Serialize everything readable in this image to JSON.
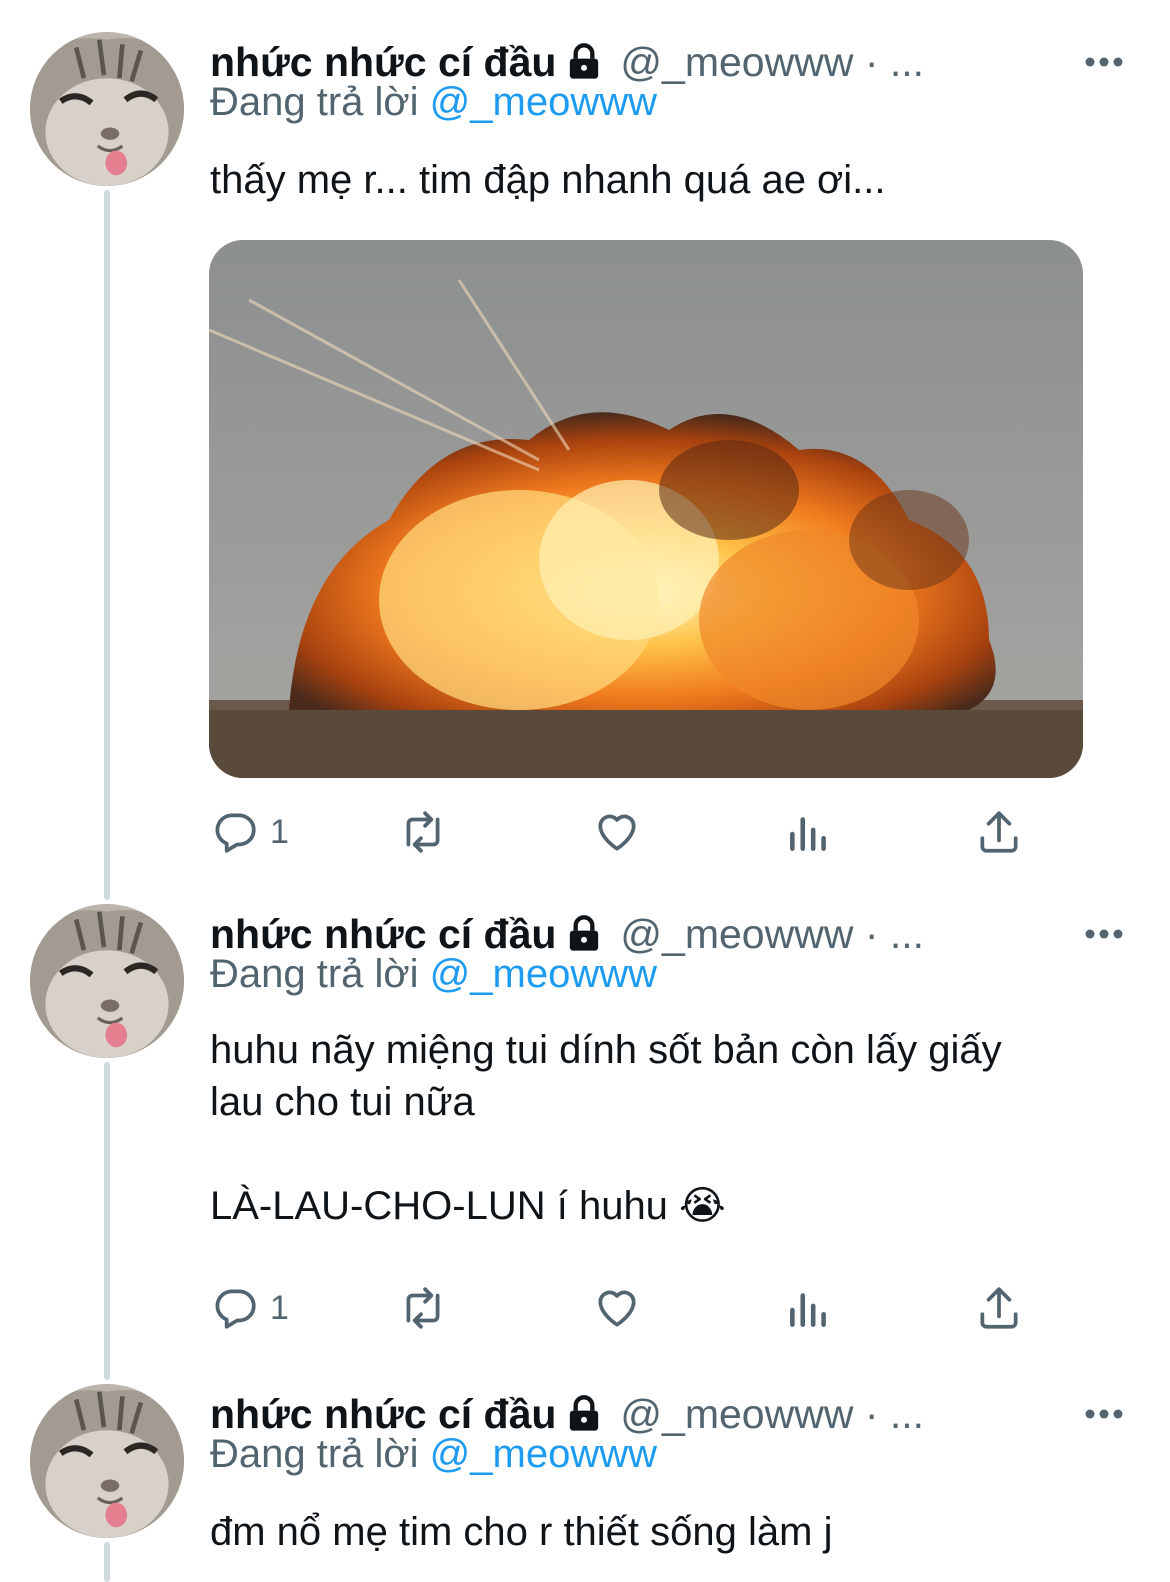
{
  "tweets": [
    {
      "display_name": "nhức nhức cí đầu",
      "handle": "@_meowww · ...",
      "reply_prefix": "Đang trả lời",
      "reply_mention": "@_meowww",
      "text": "thấy mẹ r... tim đập nhanh quá ae ơi...",
      "has_media": true,
      "reply_count": "1"
    },
    {
      "display_name": "nhức nhức cí đầu",
      "handle": "@_meowww · ...",
      "reply_prefix": "Đang trả lời",
      "reply_mention": "@_meowww",
      "text": "huhu nãy miệng tui dính sốt bản còn lấy giấy\nlau cho tui nữa\n\nLÀ-LAU-CHO-LUN í huhu 😭",
      "has_media": false,
      "reply_count": "1"
    },
    {
      "display_name": "nhức nhức cí đầu",
      "handle": "@_meowww · ...",
      "reply_prefix": "Đang trả lời",
      "reply_mention": "@_meowww",
      "text": "đm nổ mẹ tim cho r thiết sống làm j",
      "has_media": false,
      "reply_count": ""
    }
  ],
  "icons": {
    "reply": "reply-icon",
    "retweet": "retweet-icon",
    "like": "heart-icon",
    "views": "views-icon",
    "share": "share-icon",
    "lock": "lock-icon",
    "more": "more-icon"
  },
  "colors": {
    "text": "#0f1419",
    "secondary": "#536471",
    "link": "#1d9bf0",
    "thread_line": "#cfd9de"
  }
}
